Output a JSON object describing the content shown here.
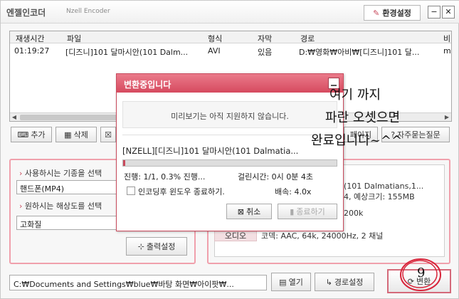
{
  "app": {
    "title": "엔젤인코더",
    "subtitle": "Nzell Encoder",
    "settings_label": "환경설정",
    "minimize_glyph": "−",
    "close_glyph": "✕"
  },
  "file_list": {
    "columns": [
      "재생시간",
      "파일",
      "형식",
      "자막",
      "경로",
      "비"
    ],
    "rows": [
      {
        "duration": "01:19:27",
        "file": "[디즈니]101 달마시안(101 Dalm...",
        "format": "AVI",
        "subtitle": "있음",
        "path": "D:₩영화₩아비₩[디즈니]101 달...",
        "extra": "m"
      }
    ]
  },
  "toolbar": {
    "add_label": "추가",
    "delete_label": "삭제",
    "partial_label": "페이지",
    "faq_label": "자주묻는질문"
  },
  "options": {
    "device_label": "사용하시는 기종을 선택",
    "device_value": "핸드폰(MP4)",
    "resolution_label": "원하시는 해상도를 선택",
    "resolution_value": "고화질",
    "output_settings_label": "출력설정"
  },
  "file_info": {
    "video_text": "(101 Dalmatians,1...",
    "video_text2": "4, 예상크기: 155MB",
    "bitrate_text": "200k",
    "audio_tag": "오디오",
    "audio_text": "코덱: AAC, 64k, 24000Hz, 2 채널"
  },
  "bottom": {
    "path": "C:₩Documents and Settings₩blue₩바탕 화면₩아이팟₩...",
    "open_label": "열기",
    "path_settings_label": "경로설정",
    "convert_label": "변환"
  },
  "dialog": {
    "title": "변환중입니다",
    "message": "미리보기는 아직 지원하지 않습니다.",
    "filename": "[NZELL][디즈니]101 달마시안(101 Dalmatia...",
    "progress_text": "진행: 1/1, 0.3% 진행...",
    "progress_fraction": 0.003,
    "elapsed": "걸린시간: 0시 0분 4초",
    "shutdown_label": "인코딩후 윈도우 종료하기.",
    "speed": "배속: 4.0x",
    "cancel_label": "취소",
    "stop_label": "종료하기"
  },
  "annotation": {
    "line1": "여기 까지",
    "line2": "파란 오셋으면",
    "line3": "완료입니다~^^",
    "number": "9"
  }
}
